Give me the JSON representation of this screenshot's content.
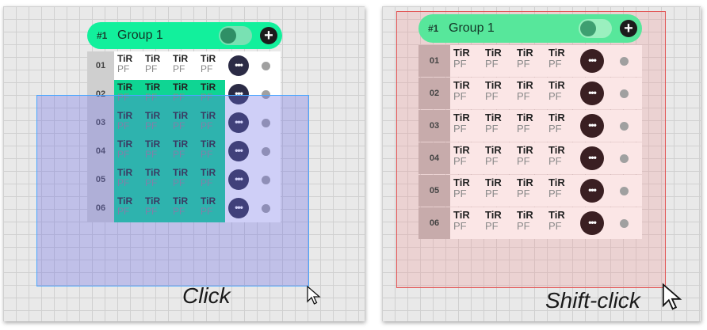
{
  "panels": {
    "left": {
      "group": {
        "num": "#1",
        "title": "Group 1"
      },
      "rows": [
        {
          "num": "01",
          "selected": false
        },
        {
          "num": "02",
          "selected": true
        },
        {
          "num": "03",
          "selected": true
        },
        {
          "num": "04",
          "selected": true
        },
        {
          "num": "05",
          "selected": true
        },
        {
          "num": "06",
          "selected": true
        }
      ],
      "cell_top": "TiR",
      "cell_bottom": "PF",
      "more_glyph": "•••",
      "caption": "Click"
    },
    "right": {
      "group": {
        "num": "#1",
        "title": "Group 1"
      },
      "rows": [
        {
          "num": "01"
        },
        {
          "num": "02"
        },
        {
          "num": "03"
        },
        {
          "num": "04"
        },
        {
          "num": "05"
        },
        {
          "num": "06"
        }
      ],
      "cell_top": "TiR",
      "cell_bottom": "PF",
      "more_glyph": "•••",
      "caption": "Shift-click"
    }
  },
  "icons": {
    "plus": "+",
    "cursor": "arrow-cursor-icon"
  },
  "colors": {
    "left_header": "#12f09c",
    "left_selected": "#0fd593",
    "selection_rect": "#4aa6ff",
    "right_header": "#57e79b",
    "right_selection_rect": "#e25656"
  }
}
